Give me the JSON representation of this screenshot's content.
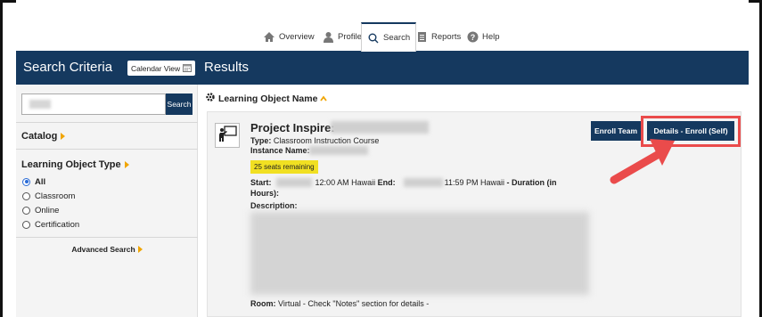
{
  "nav": {
    "items": [
      {
        "label": "Overview",
        "icon": "home-icon"
      },
      {
        "label": "Profile",
        "icon": "user-icon"
      },
      {
        "label": "Search",
        "icon": "search-icon",
        "active": true
      },
      {
        "label": "Reports",
        "icon": "reports-icon"
      },
      {
        "label": "Help",
        "icon": "help-icon"
      }
    ]
  },
  "header": {
    "search_criteria_title": "Search Criteria",
    "calendar_view_label": "Calendar View",
    "results_title": "Results"
  },
  "sidebar": {
    "search_button": "Search",
    "catalog_label": "Catalog",
    "learning_object_type_label": "Learning Object Type",
    "types": [
      "All",
      "Classroom",
      "Online",
      "Certification"
    ],
    "selected_type": "All",
    "advanced_search_label": "Advanced Search"
  },
  "results": {
    "sort_label": "Learning Object Name",
    "card": {
      "title": "Project Inspire:",
      "type_label": "Type:",
      "type_value": "Classroom Instruction Course",
      "instance_label": "Instance Name:",
      "seats_badge": "25 seats remaining",
      "start_label": "Start:",
      "start_time": "12:00 AM Hawaii",
      "end_label": "End:",
      "end_time": "11:59 PM Hawaii",
      "duration_label": "- Duration (in",
      "duration_label2": "Hours):",
      "description_label": "Description:",
      "room_label": "Room:",
      "room_value": "Virtual - Check \"Notes\" section for details -",
      "enroll_team_label": "Enroll Team",
      "details_enroll_label": "Details - Enroll (Self)"
    }
  },
  "colors": {
    "header_bg": "#15395f",
    "accent_orange": "#f0a500",
    "badge_yellow": "#f1e022",
    "annotation_red": "#ea4b4b"
  }
}
